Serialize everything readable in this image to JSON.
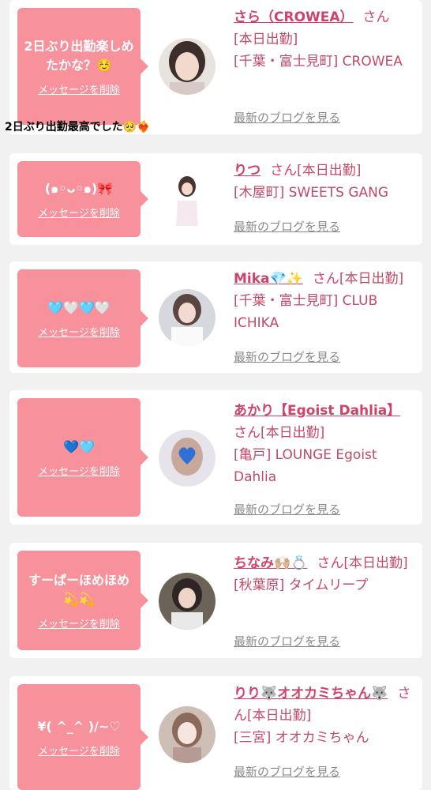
{
  "colors": {
    "bubble": "#f7919c",
    "accent": "#d0426a",
    "muted": "#8a8a8a",
    "background": "#f1f1f1"
  },
  "delete_label": "メッセージを削除",
  "blog_label": "最新のブログを見る",
  "overlay_text": "2日ぶり出勤最高でした🥺❤️‍🔥",
  "cards": [
    {
      "message": "2日ぶり出勤楽しめたかな？☺️",
      "name": "さら（CROWEA）",
      "san": "さん",
      "status": "[本日出勤]",
      "location": "[千葉・富士見町] CROWEA"
    },
    {
      "message": "(๑◦ᴗ◦๑)🎀",
      "name": "りつ",
      "san": "さん",
      "status": "[本日出勤]",
      "location": "[木屋町] SWEETS GANG"
    },
    {
      "message": "🩵🤍🩵🤍",
      "name": "Mika💎✨",
      "san": "さん",
      "status": "[本日出勤]",
      "location": "[千葉・富士見町] CLUB ICHIKA"
    },
    {
      "message": "💙🩵",
      "name": "あかり【Egoist Dahlia】",
      "san": "さん",
      "status": "[本日出勤]",
      "location": "[亀戸] LOUNGE Egoist Dahlia"
    },
    {
      "message": "すーぱーほめほめ💫💫",
      "name": "ちなみ🙌🏼💍",
      "san": "さん",
      "status": "[本日出勤]",
      "location": "[秋葉原] タイムリープ"
    },
    {
      "message": "¥( ^_^ )/~♡",
      "name": "りり🐺オオカミちゃん🐺",
      "san": "さん",
      "status": "[本日出勤]",
      "location": "[三宮] オオカミちゃん"
    }
  ]
}
